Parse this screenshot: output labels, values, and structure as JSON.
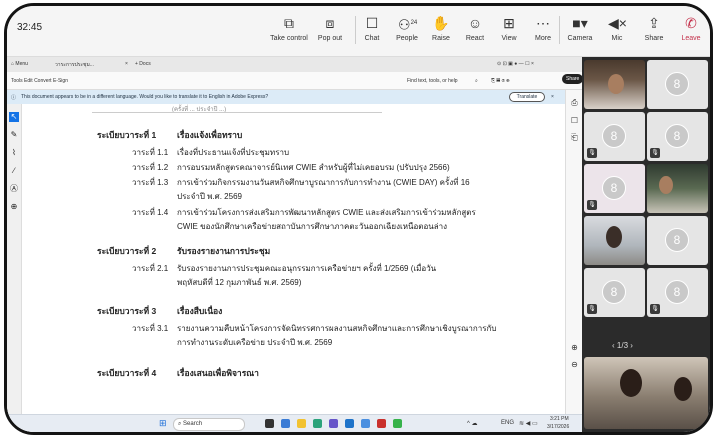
{
  "meeting": {
    "clock": "32:45",
    "tools": [
      {
        "label": "Take control",
        "icon": "take-control-icon",
        "glyph": "⧉"
      },
      {
        "label": "Pop out",
        "icon": "pop-out-icon",
        "glyph": "⧈"
      },
      {
        "label": "Chat",
        "icon": "chat-icon",
        "glyph": "💬"
      },
      {
        "label": "People",
        "icon": "people-icon",
        "glyph": "👥"
      },
      {
        "label": "Raise",
        "icon": "raise-hand-icon",
        "glyph": "✋"
      },
      {
        "label": "React",
        "icon": "react-icon",
        "glyph": "☺"
      },
      {
        "label": "View",
        "icon": "view-icon",
        "glyph": "⊞"
      },
      {
        "label": "More",
        "icon": "more-icon",
        "glyph": "⋯"
      },
      {
        "label": "Camera",
        "icon": "camera-icon",
        "glyph": "■"
      },
      {
        "label": "Mic",
        "icon": "mic-icon",
        "glyph": "◀"
      },
      {
        "label": "Share",
        "icon": "share-icon",
        "glyph": "⇪"
      },
      {
        "label": "Leave",
        "icon": "leave-icon",
        "glyph": "✆"
      }
    ],
    "people_count": "24"
  },
  "browser": {
    "tab_label": "วาระการประชุม...",
    "new_tab_label": "+ Docs",
    "menu_left": "Tools   Edit   Convert   E-Sign",
    "find_label": "Find text, tools, or help",
    "share_button": "Share",
    "banner_text": "This document appears to be in a different language. Would you like to translate it to English in Adobe Express?",
    "translate_label": "Translate"
  },
  "document": {
    "top_fragment": "(ครั้งที่ ... ประจำปี ...)",
    "agenda": [
      {
        "head": "ระเบียบวาระที่ 1",
        "title": "เรื่องแจ้งเพื่อทราบ",
        "items": [
          {
            "num": "วาระที่ 1.1",
            "text": "เรื่องที่ประธานแจ้งที่ประชุมทราบ"
          },
          {
            "num": "วาระที่ 1.2",
            "text": "การอบรมหลักสูตรคณาจารย์นิเทศ CWIE สำหรับผู้ที่ไม่เคยอบรม (ปรับปรุง 2566)"
          },
          {
            "num": "วาระที่ 1.3",
            "text": "การเข้าร่วมกิจกรรมงานวันสหกิจศึกษาบูรณาการกับการทำงาน (CWIE DAY) ครั้งที่ 16 ประจำปี พ.ศ. 2569"
          },
          {
            "num": "วาระที่ 1.4",
            "text": "การเข้าร่วมโครงการส่งเสริมการพัฒนาหลักสูตร CWIE และส่งเสริมการเข้าร่วมหลักสูตร CWIE ของนักศึกษาเครือข่ายสถาบันการศึกษาภาคตะวันออกเฉียงเหนือตอนล่าง"
          }
        ]
      },
      {
        "head": "ระเบียบวาระที่ 2",
        "title": "รับรองรายงานการประชุม",
        "items": [
          {
            "num": "วาระที่ 2.1",
            "text": "รับรองรายงานการประชุมคณะอนุกรรมการเครือข่ายฯ ครั้งที่ 1/2569 (เมื่อวันพฤหัสบดีที่ 12 กุมภาพันธ์ พ.ศ. 2569)"
          }
        ]
      },
      {
        "head": "ระเบียบวาระที่ 3",
        "title": "เรื่องสืบเนื่อง",
        "items": [
          {
            "num": "วาระที่ 3.1",
            "text": "รายงานความคืบหน้าโครงการจัดนิทรรศการผลงานสหกิจศึกษาและการศึกษาเชิงบูรณาการกับการทำงานระดับเครือข่าย ประจำปี พ.ศ. 2569"
          }
        ]
      },
      {
        "head": "ระเบียบวาระที่ 4",
        "title": "เรื่องเสนอเพื่อพิจารณา",
        "items": []
      }
    ]
  },
  "taskbar": {
    "search_label": "Search",
    "lang": "ENG",
    "time": "3:21 PM",
    "date": "3/17/2026"
  },
  "gallery": {
    "page_indicator": "1/3",
    "side_numbers": [
      "7",
      "29"
    ]
  },
  "colors": {
    "accent": "#1473e6",
    "leave": "#c4314b",
    "gallery_bg": "#2b2b2b"
  }
}
